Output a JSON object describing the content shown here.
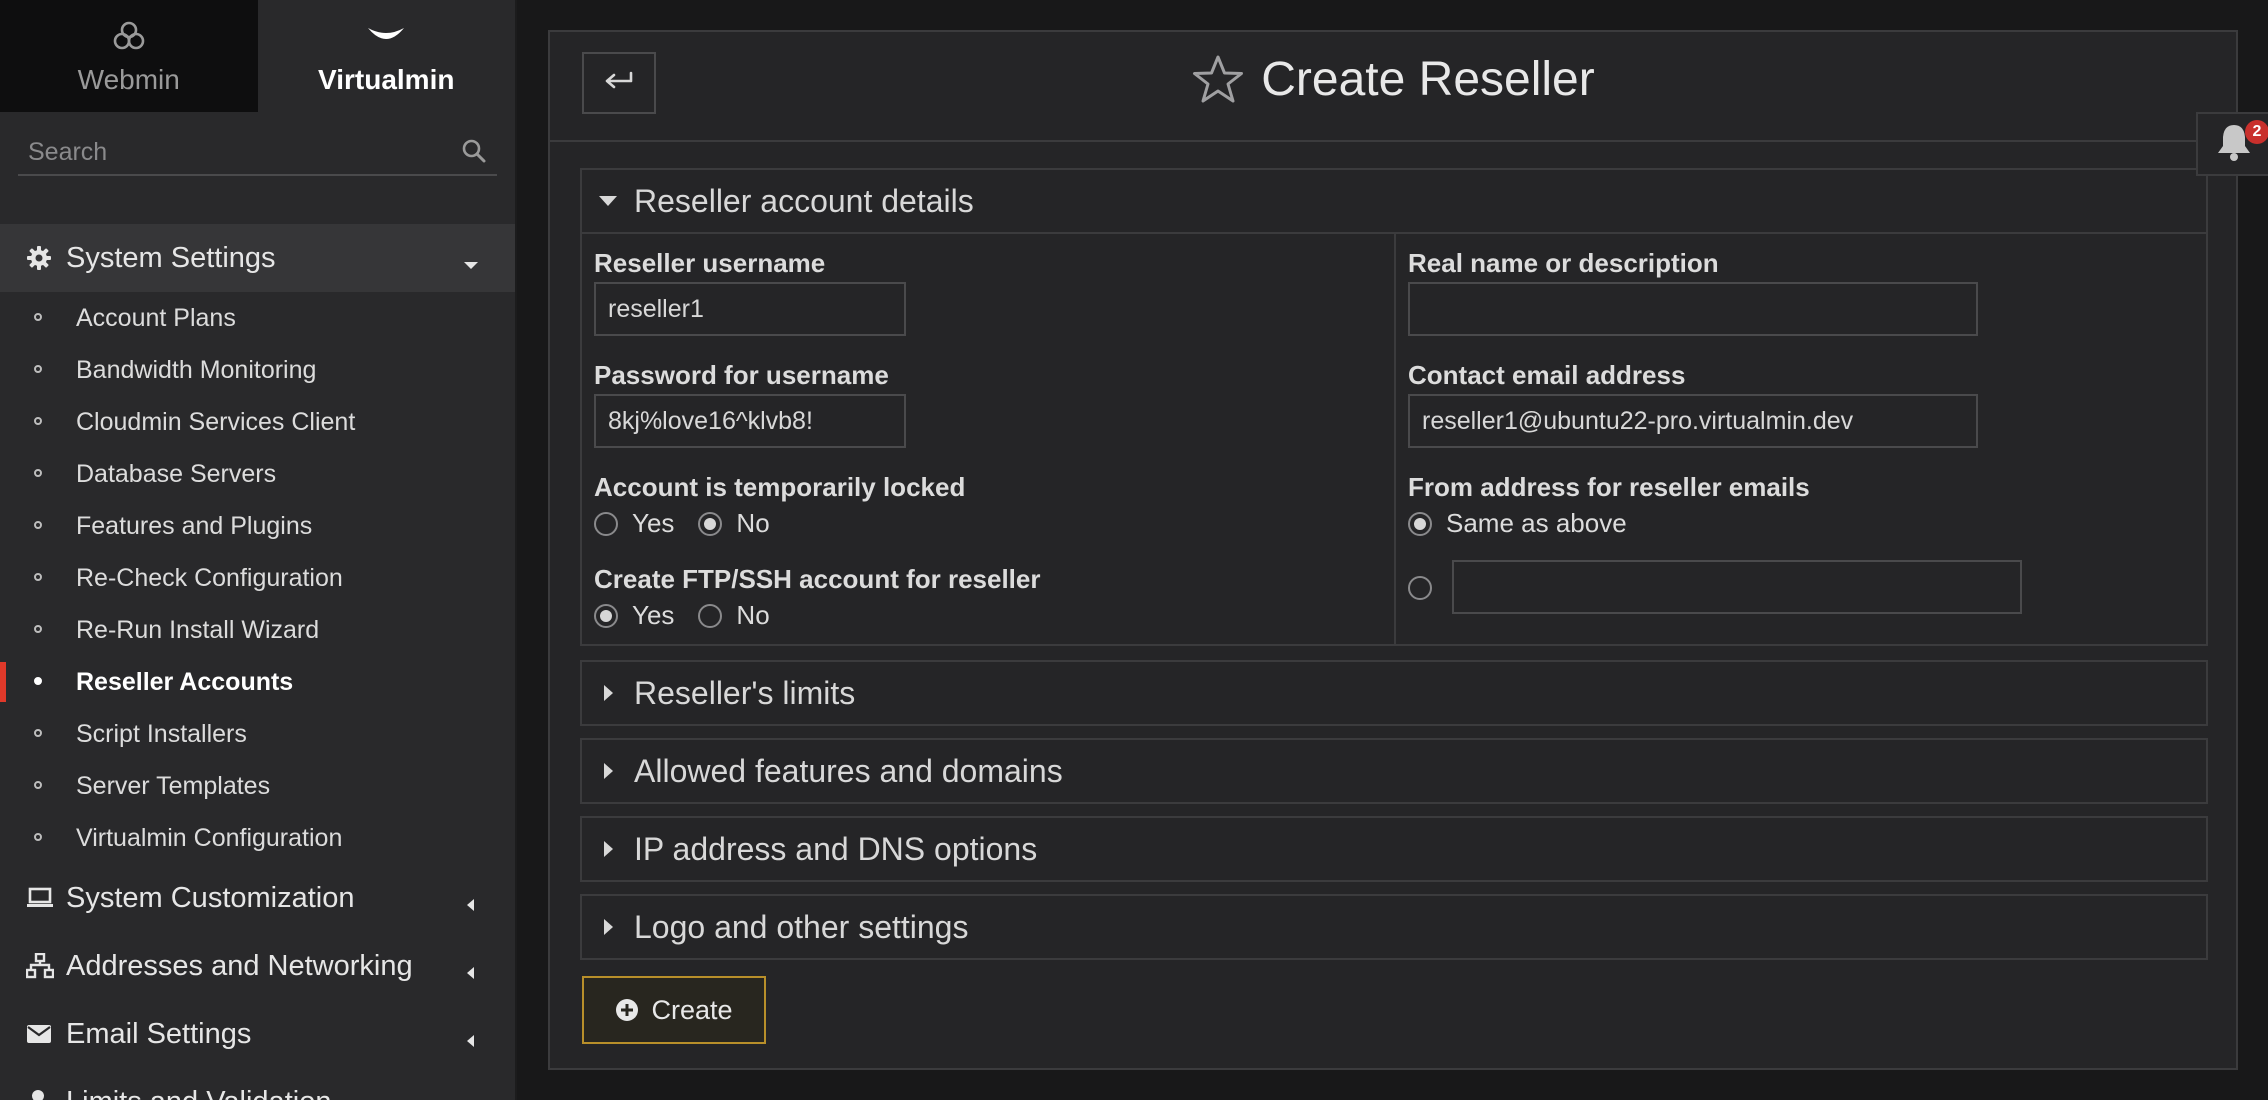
{
  "sidebar": {
    "switch": {
      "webmin_label": "Webmin",
      "virtualmin_label": "Virtualmin"
    },
    "search": {
      "placeholder": "Search"
    },
    "categories": [
      {
        "label": "System Settings",
        "icon": "gear-icon",
        "expanded": true
      },
      {
        "label": "System Customization",
        "icon": "laptop-icon",
        "expanded": false
      },
      {
        "label": "Addresses and Networking",
        "icon": "network-icon",
        "expanded": false
      },
      {
        "label": "Email Settings",
        "icon": "envelope-icon",
        "expanded": false
      },
      {
        "label": "Limits and Validation",
        "icon": "user-icon",
        "expanded": false
      }
    ],
    "system_settings_items": [
      {
        "label": "Account Plans"
      },
      {
        "label": "Bandwidth Monitoring"
      },
      {
        "label": "Cloudmin Services Client"
      },
      {
        "label": "Database Servers"
      },
      {
        "label": "Features and Plugins"
      },
      {
        "label": "Re-Check Configuration"
      },
      {
        "label": "Re-Run Install Wizard"
      },
      {
        "label": "Reseller Accounts",
        "active": true
      },
      {
        "label": "Script Installers"
      },
      {
        "label": "Server Templates"
      },
      {
        "label": "Virtualmin Configuration"
      }
    ]
  },
  "header": {
    "title": "Create Reseller",
    "notifications_count": "2"
  },
  "details": {
    "heading": "Reseller account details",
    "username_label": "Reseller username",
    "username_value": "reseller1",
    "password_label": "Password for username",
    "password_value": "8kj%love16^klvb8!",
    "locked_label": "Account is temporarily locked",
    "locked_options": [
      "Yes",
      "No"
    ],
    "locked_selected": "No",
    "ftp_label": "Create FTP/SSH account for reseller",
    "ftp_options": [
      "Yes",
      "No"
    ],
    "ftp_selected": "Yes",
    "realname_label": "Real name or description",
    "realname_value": "",
    "email_label": "Contact email address",
    "email_value": "reseller1@ubuntu22-pro.virtualmin.dev",
    "from_label": "From address for reseller emails",
    "from_option_same": "Same as above",
    "from_custom_value": ""
  },
  "sections": [
    {
      "label": "Reseller's limits"
    },
    {
      "label": "Allowed features and domains"
    },
    {
      "label": "IP address and DNS options"
    },
    {
      "label": "Logo and other settings"
    }
  ],
  "actions": {
    "create_label": "Create"
  }
}
